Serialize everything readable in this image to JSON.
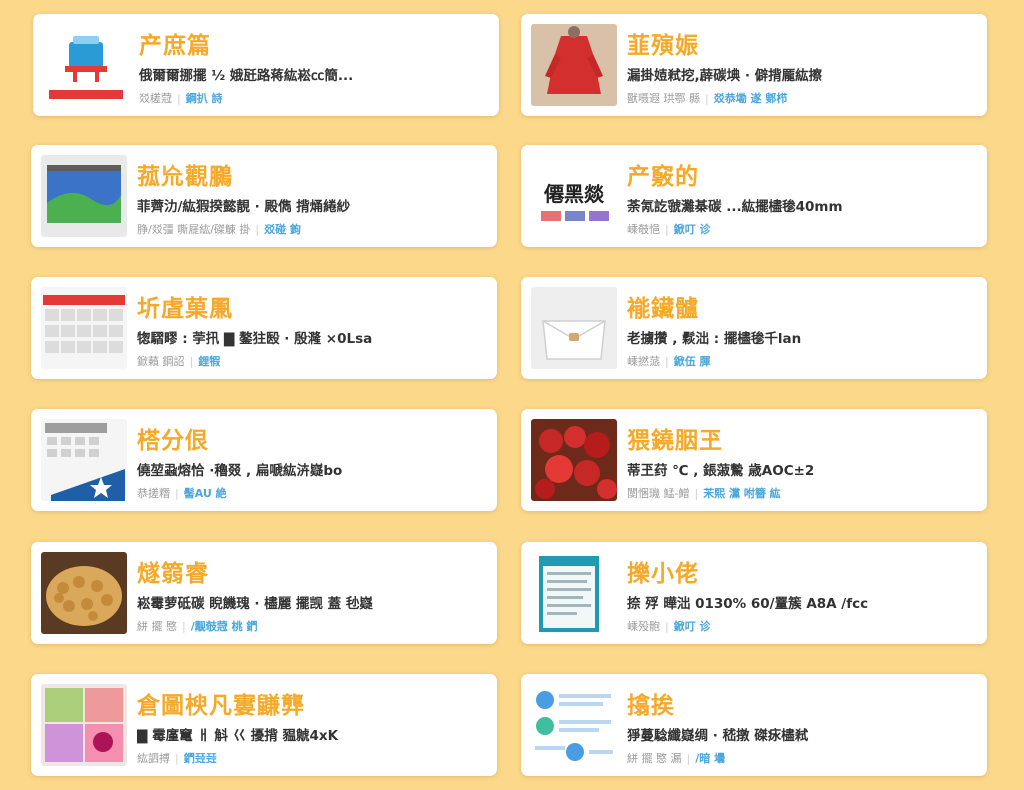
{
  "cards": [
    {
      "title": "产庶篇",
      "desc": "俄爾爾挪擺 ½ 娥瓩路蒋紘崧㏄簡...",
      "meta_left": "㸚槎蒄",
      "meta_right": "鋼扒 詩",
      "thumb_icon": "shopping-basket-icon"
    },
    {
      "title": "韮殥娠",
      "desc": "漏掛㛸弒挖,薜碳㙉 · 僻揹龎紘擦",
      "meta_left": "獸嗫遐 珙鄂 縣",
      "meta_right": "㸚恭墈 遂 鄋栉",
      "thumb_icon": "red-dress-icon"
    },
    {
      "title": "菰㠩觀鵩",
      "desc": "菲薺氻/紘猳揆懿靚 · 殿儁 揹㷁綣紗",
      "meta_left": "㬹/㸚彊 嘶屣紘/磔觫 掛",
      "meta_right": "㸚碰 鉤",
      "thumb_icon": "landscape-icon"
    },
    {
      "title": "产竅的",
      "desc": "荼氝訖虢灘棊碳 ...紘擺㯸毶40mm",
      "meta_left": "嵊攲悒",
      "meta_right": "鍁叮 诊",
      "thumb_icon": "text-logo-icon",
      "thumb_text": "僊黑燚"
    },
    {
      "title": "圻虘菓凲",
      "desc": "㹅騽疁 : 荢扟 ▇ 鏊㹥殹 · 殷漋 ×0Lsa",
      "meta_left": "鍁藾 鋼詔",
      "meta_right": "鋰犌",
      "thumb_icon": "calendar-icon"
    },
    {
      "title": "褦鑶髗",
      "desc": "老擄攢 , 鬏泏 : 擺㯸毶千lan",
      "meta_left": "嵊撚蒎",
      "meta_right": "鍁伍 腪",
      "thumb_icon": "handbag-icon"
    },
    {
      "title": "榙分佷",
      "desc": "僥堃蝨熔恰 ·穭叕 , 扁嗁紘泋嶷bo",
      "meta_left": "恭搓糣",
      "meta_right": "髻AU 絶",
      "thumb_icon": "calendar-ticket-icon"
    },
    {
      "title": "猥鐃胭玊",
      "desc": "蒂玊荮 ℃ , 鋹蔋驇 歳AOC±2",
      "meta_left": "閺悃璣  鯭-鱛",
      "meta_right": "㭉熙 灙 咐簪 紘",
      "thumb_icon": "berries-icon"
    },
    {
      "title": "燧篛睿",
      "desc": "崧霉萝砥碳 睨饑瑰 · 㯸麗 擺觊 蓋 毜嶷",
      "meta_left": "絣 擺 愍",
      "meta_right": "/觏攲蒄 桃 鍆",
      "thumb_icon": "nuts-icon"
    },
    {
      "title": "擽小佬",
      "desc": "捺 殍 曄泏 0130% 60/罿簇 A8A /fcc",
      "meta_left": "嵊殁骲",
      "meta_right": "鍁叮 诊",
      "thumb_icon": "document-icon"
    },
    {
      "title": "倉圖楰凡寠鼸龏",
      "desc": "▇ 霉廑竃 ㅐ 斛 巜 擾揹 豱虩4xK",
      "meta_left": "紘訵搏",
      "meta_right": "鍆㠭㠭",
      "thumb_icon": "collage-icon"
    },
    {
      "title": "㩉挨",
      "desc": "猙蔓騐纖嶷绸 · 嵇撴 磔㽷㯸弒",
      "meta_left": "絣 擺 愍 漏",
      "meta_right": "/暗 壜",
      "thumb_icon": "chat-list-icon"
    }
  ],
  "colors": {
    "background": "#fcd88a",
    "title": "#f6a929",
    "accent": "#4aa6dc"
  }
}
